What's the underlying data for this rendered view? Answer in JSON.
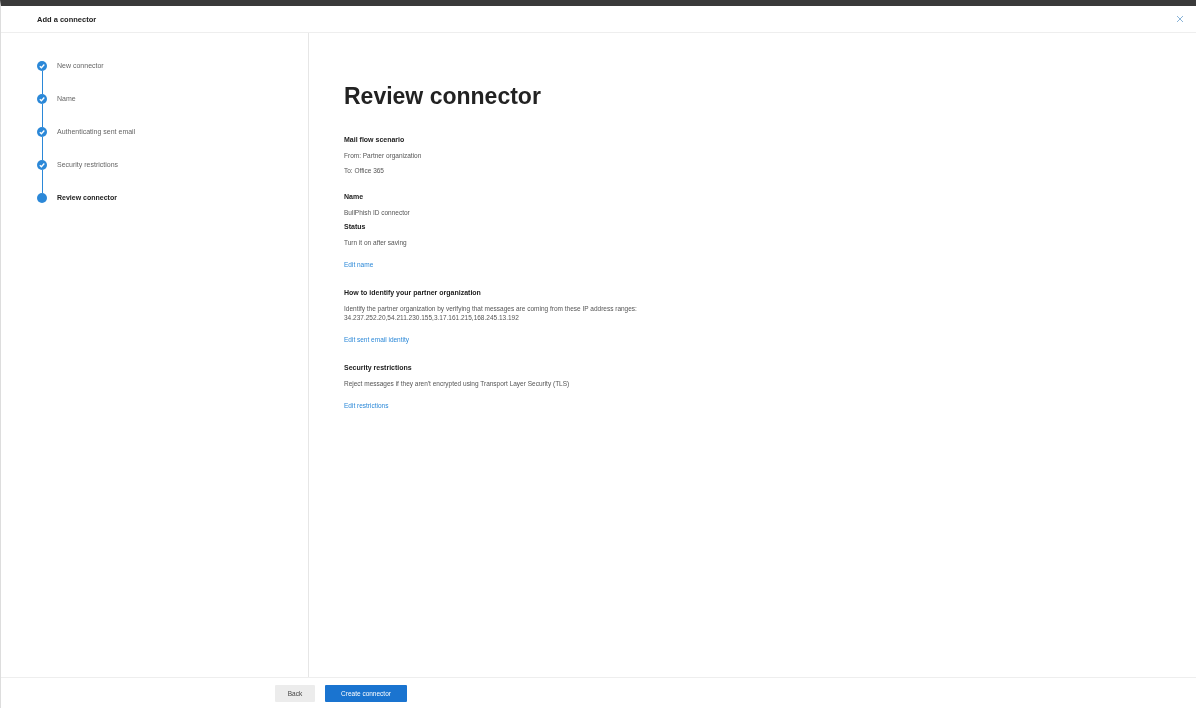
{
  "window": {
    "title": "Add a connector"
  },
  "steps": [
    {
      "label": "New connector",
      "completed": true,
      "selected": false
    },
    {
      "label": "Name",
      "completed": true,
      "selected": false
    },
    {
      "label": "Authenticating sent email",
      "completed": true,
      "selected": false
    },
    {
      "label": "Security restrictions",
      "completed": true,
      "selected": false
    },
    {
      "label": "Review connector",
      "completed": false,
      "selected": true
    }
  ],
  "page_title": "Review connector",
  "sections": [
    {
      "heading": "Mail flow scenario",
      "lines": [
        "From: Partner organization",
        "To: Office 365"
      ]
    },
    {
      "heading": "Name",
      "lines": [
        "BullPhish ID connector"
      ],
      "tight": true
    },
    {
      "heading": "Status",
      "lines": [
        "Turn it on after saving"
      ],
      "link": "Edit name"
    },
    {
      "heading": "How to identify your partner organization",
      "lines": [
        "Identify the partner organization by verifying that messages are coming from these IP address ranges: 34.237.252.20,54.211.230.155,3.17.161.215,168.245.13.192"
      ],
      "link": "Edit sent email identity"
    },
    {
      "heading": "Security restrictions",
      "lines": [
        "Reject messages if they aren't encrypted using Transport Layer Security (TLS)"
      ],
      "link": "Edit restrictions"
    }
  ],
  "buttons": [
    {
      "label": "Back",
      "kind": "secondary"
    },
    {
      "label": "Create connector",
      "kind": "primary"
    }
  ]
}
